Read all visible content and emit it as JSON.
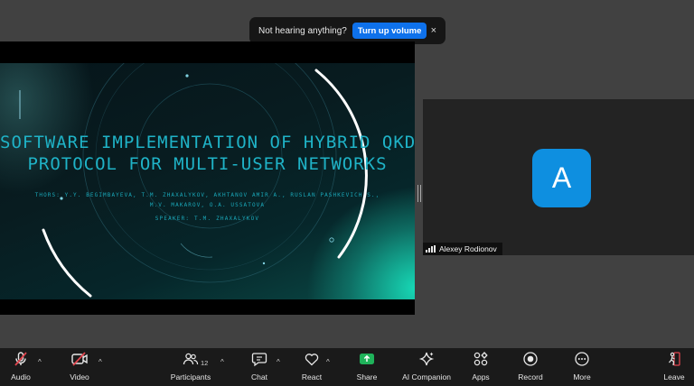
{
  "banner": {
    "text": "Not hearing anything?",
    "button": "Turn up volume",
    "close": "×"
  },
  "slide": {
    "title_line1": "SOFTWARE IMPLEMENTATION OF HYBRID QKD",
    "title_line2": "PROTOCOL FOR MULTI-USER NETWORKS",
    "authors_line1": "THORS: Y.Y. BEGIMBAYEVA, T.M. ZHAXALYKOV, AKHTANOV AMIR A., RUSLAN PASHKEVICH S.,",
    "authors_line2": "M.V. MAKAROV, O.A. USSATOVA",
    "speaker": "SPEAKER: T.M. ZHAXALYKOV"
  },
  "participant": {
    "initial": "A",
    "name": "Alexey Rodionov",
    "avatar_color": "#0e8fe0"
  },
  "toolbar": {
    "audio": "Audio",
    "video": "Video",
    "participants": "Participants",
    "participants_count": "12",
    "chat": "Chat",
    "react": "React",
    "share": "Share",
    "ai_companion": "AI Companion",
    "apps": "Apps",
    "record": "Record",
    "more": "More",
    "leave": "Leave",
    "caret": "^"
  },
  "colors": {
    "accent": "#0e71eb",
    "share_green": "#1fb25a",
    "muted_red": "#e0454e",
    "title_teal": "#1fb3c7"
  },
  "icons": {
    "audio": "microphone-muted-icon",
    "video": "video-camera-off-icon",
    "participants": "people-icon",
    "chat": "chat-bubble-icon",
    "react": "heart-icon",
    "share": "share-screen-arrow-icon",
    "ai_companion": "sparkle-icon",
    "apps": "apps-grid-icon",
    "record": "record-circle-icon",
    "more": "ellipsis-circle-icon",
    "leave": "leave-door-icon"
  }
}
